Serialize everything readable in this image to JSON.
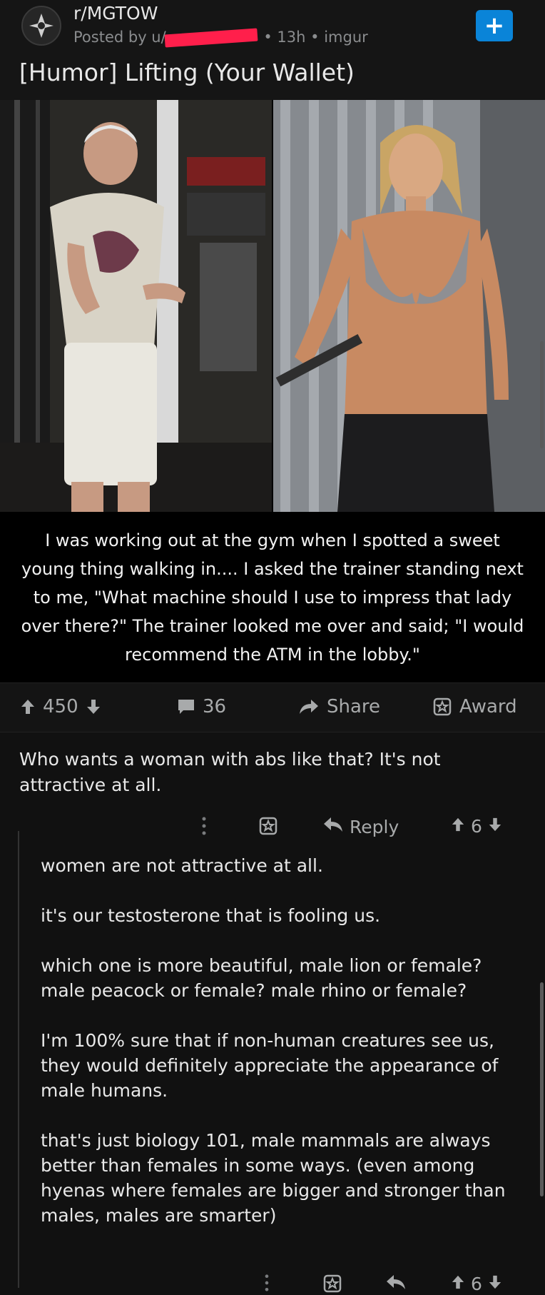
{
  "post": {
    "subreddit": "r/MGTOW",
    "posted_by": "Posted by u/",
    "meta": "• 13h • imgur",
    "title": "[Humor] Lifting (Your Wallet)",
    "caption": "I was working out at the gym when I spotted a sweet young thing walking in.... I asked the trainer standing next to me, \"What machine should I use to impress that lady over there?\" The trainer looked me over and said; \"I would recommend the ATM in the lobby.\"",
    "join_button": "+"
  },
  "actions": {
    "upvotes": "450",
    "comments": "36",
    "share": "Share",
    "award": "Award"
  },
  "comment": {
    "text": "Who wants a woman with abs like that? It's not attractive at all.",
    "reply_label": "Reply",
    "votes": "6"
  },
  "reply": {
    "paragraphs": [
      "women are not attractive at all.",
      "it's our testosterone that is fooling us.",
      "which one is more beautiful, male lion or female? male peacock or female? male rhino or female?",
      "I'm 100% sure that if non-human creatures see us, they would definitely appreciate the appearance of male humans.",
      "that's just biology 101, male mammals are always better than females in some ways. (even among hyenas where females are bigger and stronger than males, males are smarter)"
    ],
    "votes": "6"
  },
  "colors": {
    "background": "#111111",
    "accent_blue": "#0a84d8",
    "redaction": "#ff1f4b",
    "muted_text": "#a8aaab"
  },
  "icons": [
    "mgtow-logo-icon",
    "plus-icon",
    "upvote-icon",
    "downvote-icon",
    "comment-icon",
    "share-icon",
    "award-icon",
    "more-icon",
    "reply-icon"
  ]
}
